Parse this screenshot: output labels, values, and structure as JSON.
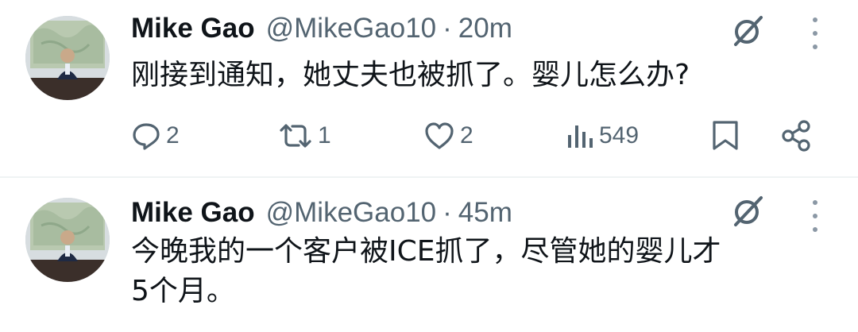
{
  "tweets": [
    {
      "author_name": "Mike Gao",
      "handle": "@MikeGao10",
      "separator": "·",
      "time": "20m",
      "text": "刚接到通知，她丈夫也被抓了。婴儿怎么办?",
      "actions": {
        "replies": "2",
        "retweets": "1",
        "likes": "2",
        "views": "549"
      },
      "icons": [
        "reply-icon",
        "retweet-icon",
        "like-icon",
        "views-icon",
        "bookmark-icon",
        "share-icon",
        "grok-icon",
        "more-icon"
      ]
    },
    {
      "author_name": "Mike Gao",
      "handle": "@MikeGao10",
      "separator": "·",
      "time": "45m",
      "text_line1": "今晚我的一个客户被ICE抓了，尽管她的婴儿才",
      "text_line2": "5个月。",
      "icons": [
        "grok-icon",
        "more-icon"
      ]
    }
  ],
  "colors": {
    "text_primary": "#0f1419",
    "text_secondary": "#536471",
    "divider": "#eff3f4"
  }
}
